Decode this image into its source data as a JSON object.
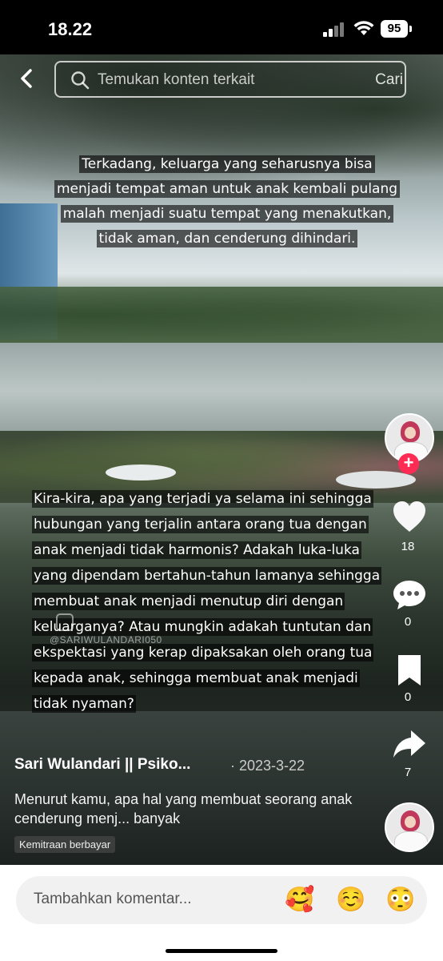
{
  "status_bar": {
    "time": "18.22",
    "battery": "95"
  },
  "search": {
    "placeholder": "Temukan konten terkait",
    "action_label": "Cari"
  },
  "video": {
    "caption_top": "Terkadang, keluarga yang seharusnya bisa menjadi tempat aman untuk anak kembali pulang malah menjadi suatu tempat yang menakutkan, tidak aman, dan cenderung dihindari.",
    "caption_bottom": "Kira-kira, apa yang terjadi ya selama ini sehingga hubungan yang terjalin antara orang tua dengan anak menjadi tidak harmonis? Adakah luka-luka yang dipendam bertahun-tahun lamanya sehingga membuat anak menjadi menutup diri dengan keluarganya? Atau mungkin adakah tuntutan dan ekspektasi yang kerap dipaksakan oleh orang tua kepada anak, sehingga membuat anak menjadi tidak nyaman?",
    "watermark": "@SARIWULANDARI050"
  },
  "actions": {
    "likes": "18",
    "comments": "0",
    "saves": "0",
    "shares": "7"
  },
  "post": {
    "author": "Sari Wulandari || Psiko...",
    "date": "· 2023-3-22",
    "description": "Menurut kamu, apa hal yang membuat seorang anak cenderung menj... banyak",
    "badge": "Kemitraan berbayar"
  },
  "comment_bar": {
    "placeholder": "Tambahkan komentar...",
    "emojis": [
      "🥰",
      "☺️",
      "😳"
    ]
  },
  "colors": {
    "follow": "#fe2c55",
    "background": "#000000"
  }
}
